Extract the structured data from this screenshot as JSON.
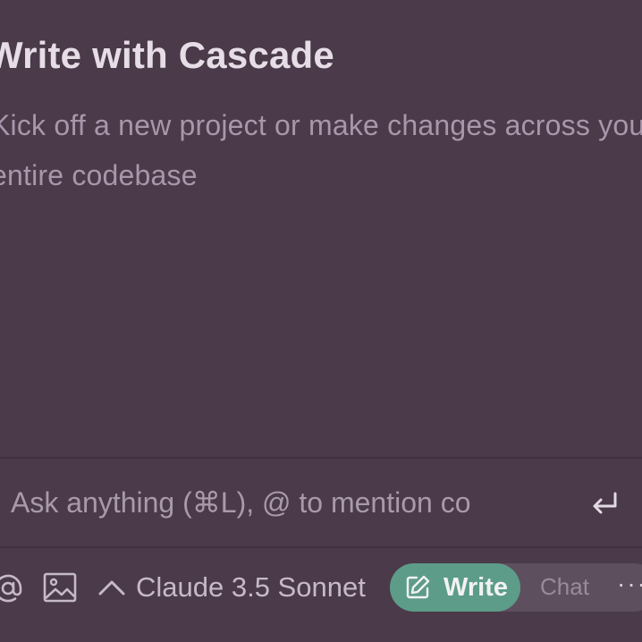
{
  "heading": "Write with Cascade",
  "subtitle": "Kick off a new project or make changes across your entire codebase",
  "input": {
    "placeholder": "Ask anything (⌘L), @ to mention co",
    "value": ""
  },
  "toolbar": {
    "at_icon": "at-sign-icon",
    "image_icon": "image-icon",
    "model_label": "Claude 3.5 Sonnet",
    "write_label": "Write",
    "chat_label": "Chat",
    "more_label": "···"
  },
  "colors": {
    "background": "#4a3a4a",
    "accent": "#5d9c88",
    "heading": "#e6dde6",
    "muted_text": "#a897aa"
  }
}
